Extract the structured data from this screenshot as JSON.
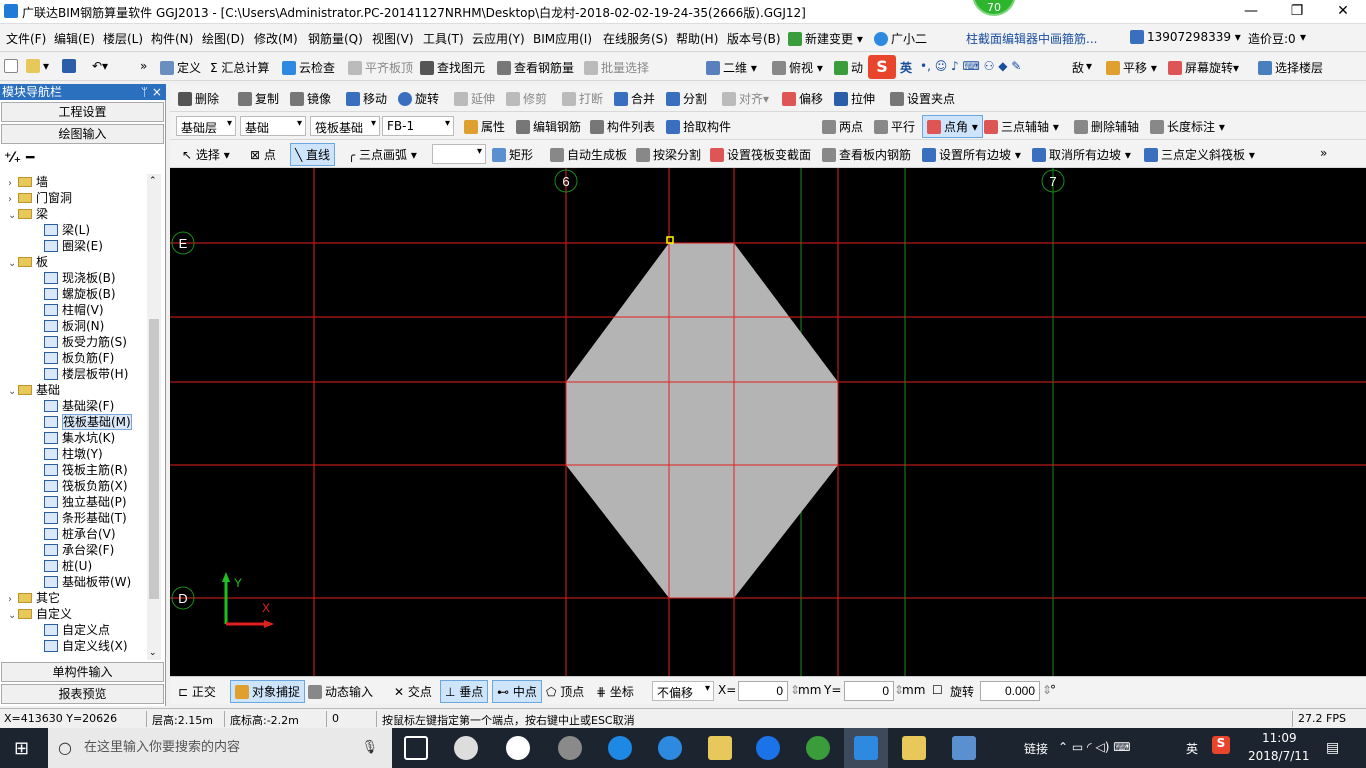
{
  "window": {
    "title": "广联达BIM钢筋算量软件 GGJ2013 - [C:\\Users\\Administrator.PC-20141127NRHM\\Desktop\\白龙村-2018-02-02-19-24-35(2666版).GGJ12]",
    "badge": "70",
    "min": "—",
    "restore": "❐",
    "close": "✕"
  },
  "menu": [
    "文件(F)",
    "编辑(E)",
    "楼层(L)",
    "构件(N)",
    "绘图(D)",
    "修改(M)",
    "钢筋量(Q)",
    "视图(V)",
    "工具(T)",
    "云应用(Y)",
    "BIM应用(I)",
    "在线服务(S)",
    "帮助(H)",
    "版本号(B)",
    "新建变更",
    "广小二",
    "柱截面编辑器中画箍筋...",
    "13907298339",
    "造价豆:0"
  ],
  "toolbar1": [
    "定义",
    "Σ 汇总计算",
    "云检查",
    "平齐板顶",
    "查找图元",
    "查看钢筋量",
    "批量选择",
    "二维",
    "俯视",
    "动",
    "英",
    "平移",
    "屏幕旋转",
    "选择楼层",
    "敌"
  ],
  "toolbar2": [
    "删除",
    "复制",
    "镜像",
    "移动",
    "旋转",
    "延伸",
    "修剪",
    "打断",
    "合并",
    "分割",
    "对齐",
    "偏移",
    "拉伸",
    "设置夹点"
  ],
  "toolbar3": {
    "floor": "基础层",
    "category": "基础",
    "type": "筏板基础",
    "element": "FB-1",
    "items": [
      "属性",
      "编辑钢筋",
      "构件列表",
      "拾取构件"
    ],
    "snap": [
      "两点",
      "平行",
      "点角",
      "三点辅轴",
      "删除辅轴",
      "长度标注"
    ]
  },
  "toolbar4": [
    "选择",
    "点",
    "直线",
    "三点画弧",
    "矩形",
    "自动生成板",
    "按梁分割",
    "设置筏板变截面",
    "查看板内钢筋",
    "设置所有边坡",
    "取消所有边坡",
    "三点定义斜筏板"
  ],
  "nav": {
    "header": "模块导航栏",
    "pin": "ᛘ ×",
    "project_settings": "工程设置",
    "drawing_input": "绘图输入",
    "single_input": "单构件输入",
    "report_preview": "报表预览"
  },
  "tree": [
    {
      "label": "墙",
      "level": 0,
      "type": "folder",
      "exp": "›"
    },
    {
      "label": "门窗洞",
      "level": 0,
      "type": "folder",
      "exp": "›"
    },
    {
      "label": "梁",
      "level": 0,
      "type": "folder",
      "exp": "⌄"
    },
    {
      "label": "梁(L)",
      "level": 1,
      "type": "leaf"
    },
    {
      "label": "圈梁(E)",
      "level": 1,
      "type": "leaf"
    },
    {
      "label": "板",
      "level": 0,
      "type": "folder",
      "exp": "⌄"
    },
    {
      "label": "现浇板(B)",
      "level": 1,
      "type": "leaf"
    },
    {
      "label": "螺旋板(B)",
      "level": 1,
      "type": "leaf"
    },
    {
      "label": "柱帽(V)",
      "level": 1,
      "type": "leaf"
    },
    {
      "label": "板洞(N)",
      "level": 1,
      "type": "leaf"
    },
    {
      "label": "板受力筋(S)",
      "level": 1,
      "type": "leaf"
    },
    {
      "label": "板负筋(F)",
      "level": 1,
      "type": "leaf"
    },
    {
      "label": "楼层板带(H)",
      "level": 1,
      "type": "leaf"
    },
    {
      "label": "基础",
      "level": 0,
      "type": "folder",
      "exp": "⌄"
    },
    {
      "label": "基础梁(F)",
      "level": 1,
      "type": "leaf"
    },
    {
      "label": "筏板基础(M)",
      "level": 1,
      "type": "leaf",
      "selected": true
    },
    {
      "label": "集水坑(K)",
      "level": 1,
      "type": "leaf"
    },
    {
      "label": "柱墩(Y)",
      "level": 1,
      "type": "leaf"
    },
    {
      "label": "筏板主筋(R)",
      "level": 1,
      "type": "leaf"
    },
    {
      "label": "筏板负筋(X)",
      "level": 1,
      "type": "leaf"
    },
    {
      "label": "独立基础(P)",
      "level": 1,
      "type": "leaf"
    },
    {
      "label": "条形基础(T)",
      "level": 1,
      "type": "leaf"
    },
    {
      "label": "桩承台(V)",
      "level": 1,
      "type": "leaf"
    },
    {
      "label": "承台梁(F)",
      "level": 1,
      "type": "leaf"
    },
    {
      "label": "桩(U)",
      "level": 1,
      "type": "leaf"
    },
    {
      "label": "基础板带(W)",
      "level": 1,
      "type": "leaf"
    },
    {
      "label": "其它",
      "level": 0,
      "type": "folder",
      "exp": "›"
    },
    {
      "label": "自定义",
      "level": 0,
      "type": "folder",
      "exp": "⌄"
    },
    {
      "label": "自定义点",
      "level": 1,
      "type": "leaf"
    },
    {
      "label": "自定义线(X)",
      "level": 1,
      "type": "leaf"
    }
  ],
  "canvas": {
    "axis_labels": {
      "col6": "6",
      "col7": "7",
      "rowE": "E",
      "rowD": "D"
    },
    "ucs": {
      "x": "X",
      "y": "Y"
    },
    "colors": {
      "grid_red": "#e02020",
      "grid_green": "#1a8a1a",
      "slab": "#b4b4b4",
      "cursor": "#ffff00"
    }
  },
  "bottombar": {
    "ortho": "正交",
    "snap": "对象捕捉",
    "dynamic": "动态输入",
    "intersect": "交点",
    "perp": "垂点",
    "mid": "中点",
    "vertex": "顶点",
    "coord": "坐标",
    "offset_mode": "不偏移",
    "x_label": "X=",
    "x_value": "0",
    "y_label": "Y=",
    "y_value": "0",
    "unit": "mm",
    "rotate": "旋转",
    "rotate_value": "0.000",
    "deg": "°"
  },
  "status": {
    "coords": "X=413630 Y=20626",
    "floor_height": "层高:2.15m",
    "bottom_height": "底标高:-2.2m",
    "num": "0",
    "hint": "按鼠标左键指定第一个端点，按右键中止或ESC取消",
    "fps": "27.2 FPS"
  },
  "taskbar": {
    "search_placeholder": "在这里输入你要搜索的内容",
    "network": "链接",
    "lang": "英",
    "time": "11:09",
    "date": "2018/7/11"
  }
}
